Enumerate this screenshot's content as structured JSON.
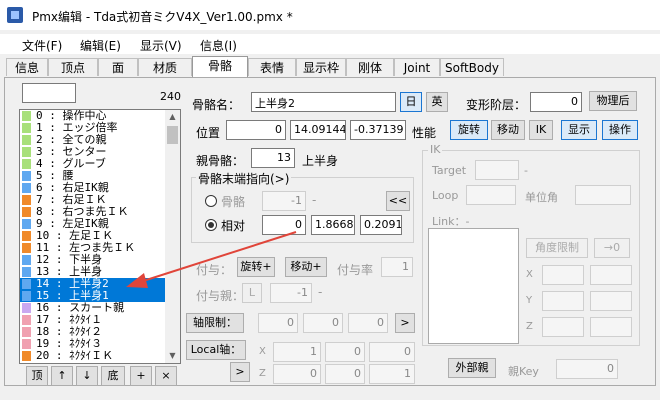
{
  "window": {
    "title": "Pmx编辑 - Tda式初音ミクV4X_Ver1.00.pmx *"
  },
  "menu": [
    "文件(F)",
    "编辑(E)",
    "显示(V)",
    "信息(I)"
  ],
  "tabs": [
    "信息",
    "顶点",
    "面",
    "材质",
    "骨骼",
    "表情",
    "显示枠",
    "刚体",
    "Joint",
    "SoftBody"
  ],
  "active_tab": "骨骼",
  "bone_list": {
    "filter_value": "",
    "count": "240",
    "rows": [
      {
        "text": "0 : 操作中心",
        "color": "#a8e07a"
      },
      {
        "text": "1 : エッジ倍率",
        "color": "#a8e07a"
      },
      {
        "text": "2 : 全ての親",
        "color": "#a8e07a"
      },
      {
        "text": "3 : センター",
        "color": "#a8e07a"
      },
      {
        "text": "4 : グルーブ",
        "color": "#a8e07a"
      },
      {
        "text": "5 : 腰",
        "color": "#5fa8f0"
      },
      {
        "text": "6 : 右足IK親",
        "color": "#5fa8f0"
      },
      {
        "text": "7 : 右足ＩＫ",
        "color": "#f08a2a"
      },
      {
        "text": "8 : 右つま先ＩＫ",
        "color": "#f08a2a"
      },
      {
        "text": "9 : 左足IK親",
        "color": "#5fa8f0"
      },
      {
        "text": "10 : 左足ＩＫ",
        "color": "#f08a2a"
      },
      {
        "text": "11 : 左つま先ＩＫ",
        "color": "#f08a2a"
      },
      {
        "text": "12 : 下半身",
        "color": "#5fa8f0"
      },
      {
        "text": "13 : 上半身",
        "color": "#5fa8f0"
      },
      {
        "text": "14 : 上半身2",
        "color": "#5fa8f0",
        "selected": true
      },
      {
        "text": "15 : 上半身1",
        "color": "#5fa8f0",
        "selected": true
      },
      {
        "text": "16 : スカート親",
        "color": "#c9a8f0"
      },
      {
        "text": "17 : ﾈｸﾀｲ１",
        "color": "#f0a0b0"
      },
      {
        "text": "18 : ﾈｸﾀｲ２",
        "color": "#f0a0b0"
      },
      {
        "text": "19 : ﾈｸﾀｲ３",
        "color": "#f0a0b0"
      },
      {
        "text": "20 : ﾈｸﾀｲＩＫ",
        "color": "#f08a2a"
      }
    ],
    "buttons": [
      "顶",
      "↑",
      "↓",
      "底",
      "+",
      "×"
    ]
  },
  "bone": {
    "name_label": "骨骼名：",
    "name_value": "上半身2",
    "lang_jp": "日",
    "lang_en": "英",
    "deform_label": "变形阶层：",
    "deform_value": "0",
    "physics_after": "物理后",
    "position_label": "位置",
    "pos_x": "0",
    "pos_y": "14.09144",
    "pos_z": "-0.37139",
    "performance_label": "性能",
    "perf_rotate": "旋转",
    "perf_move": "移动",
    "perf_ik": "IK",
    "perf_show": "显示",
    "perf_operate": "操作",
    "parent_label": "親骨骼：",
    "parent_value": "13",
    "parent_name": "上半身"
  },
  "tail": {
    "title": "骨骼末端指向(>)",
    "opt_bone": "骨骼",
    "bone_value": "-1",
    "bone_dash": "-",
    "pick_button": "<<",
    "opt_relative": "相对",
    "rel_x": "0",
    "rel_y": "1.8668",
    "rel_z": "0.2091"
  },
  "grant": {
    "label": "付与：",
    "rotate": "旋转+",
    "move": "移动+",
    "rate_label": "付与率",
    "rate_value": "1",
    "parent_label": "付与親：",
    "l_button": "L",
    "parent_value": "-1",
    "parent_dash": "-"
  },
  "axis_limit": {
    "label": "轴限制：",
    "x": "0",
    "y": "0",
    "z": "0",
    "arrow": ">"
  },
  "local_axis": {
    "label": "Local轴：",
    "arrow": ">",
    "row_x": {
      "axis": "X",
      "a": "1",
      "b": "0",
      "c": "0"
    },
    "row_z": {
      "axis": "Z",
      "a": "0",
      "b": "0",
      "c": "1"
    }
  },
  "ik": {
    "title": "IK",
    "target_label": "Target",
    "target_dash": "-",
    "loop_label": "Loop",
    "unit_angle_label": "单位角",
    "link_label": "Link：-",
    "angle_limit_button": "角度限制",
    "to_zero_button": "→0",
    "x_label": "X",
    "y_label": "Y",
    "z_label": "Z"
  },
  "footer": {
    "external_parent_button": "外部親",
    "key_label": "親Key",
    "key_value": "0"
  },
  "colors": {
    "selection": "#0078d7",
    "arrow": "#e0453a",
    "accent_border": "#1b76d2"
  }
}
